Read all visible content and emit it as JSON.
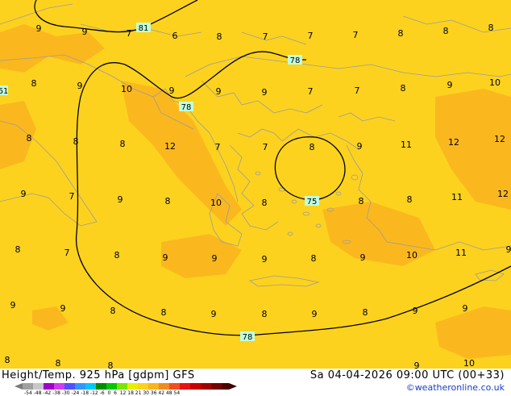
{
  "footer": {
    "title": "Height/Temp. 925 hPa [gdpm] GFS",
    "datetime": "Sa 04-04-2026 09:00 UTC (00+33)",
    "credit": "©weatheronline.co.uk",
    "scale_labels": "-54 -48 -42 -38 -30 -24 -18 -12 -6  0  6  12 18 21 30 36 42 48 54"
  },
  "colors": {
    "background": "#fcd21e",
    "warm_patch": "#fab41e",
    "coast": "#9c9c9c",
    "contour": "#000000",
    "contour_label_bg": "#c0ffe0"
  },
  "contour_labels": [
    "81",
    "78",
    "78",
    "61",
    "75",
    "78"
  ],
  "temperature_labels": [
    "9",
    "9",
    "7",
    "6",
    "8",
    "7",
    "7",
    "7",
    "8",
    "8",
    "8",
    "8",
    "9",
    "10",
    "9",
    "9",
    "9",
    "7",
    "7",
    "8",
    "9",
    "10",
    "8",
    "8",
    "8",
    "12",
    "7",
    "7",
    "8",
    "9",
    "11",
    "12",
    "12",
    "9",
    "7",
    "9",
    "8",
    "10",
    "8",
    "8",
    "8",
    "11",
    "12",
    "8",
    "7",
    "8",
    "9",
    "9",
    "9",
    "8",
    "9",
    "10",
    "11",
    "9",
    "9",
    "9",
    "8",
    "8",
    "9",
    "8",
    "9",
    "8",
    "9",
    "9",
    "8",
    "8",
    "8",
    "9",
    "10"
  ]
}
